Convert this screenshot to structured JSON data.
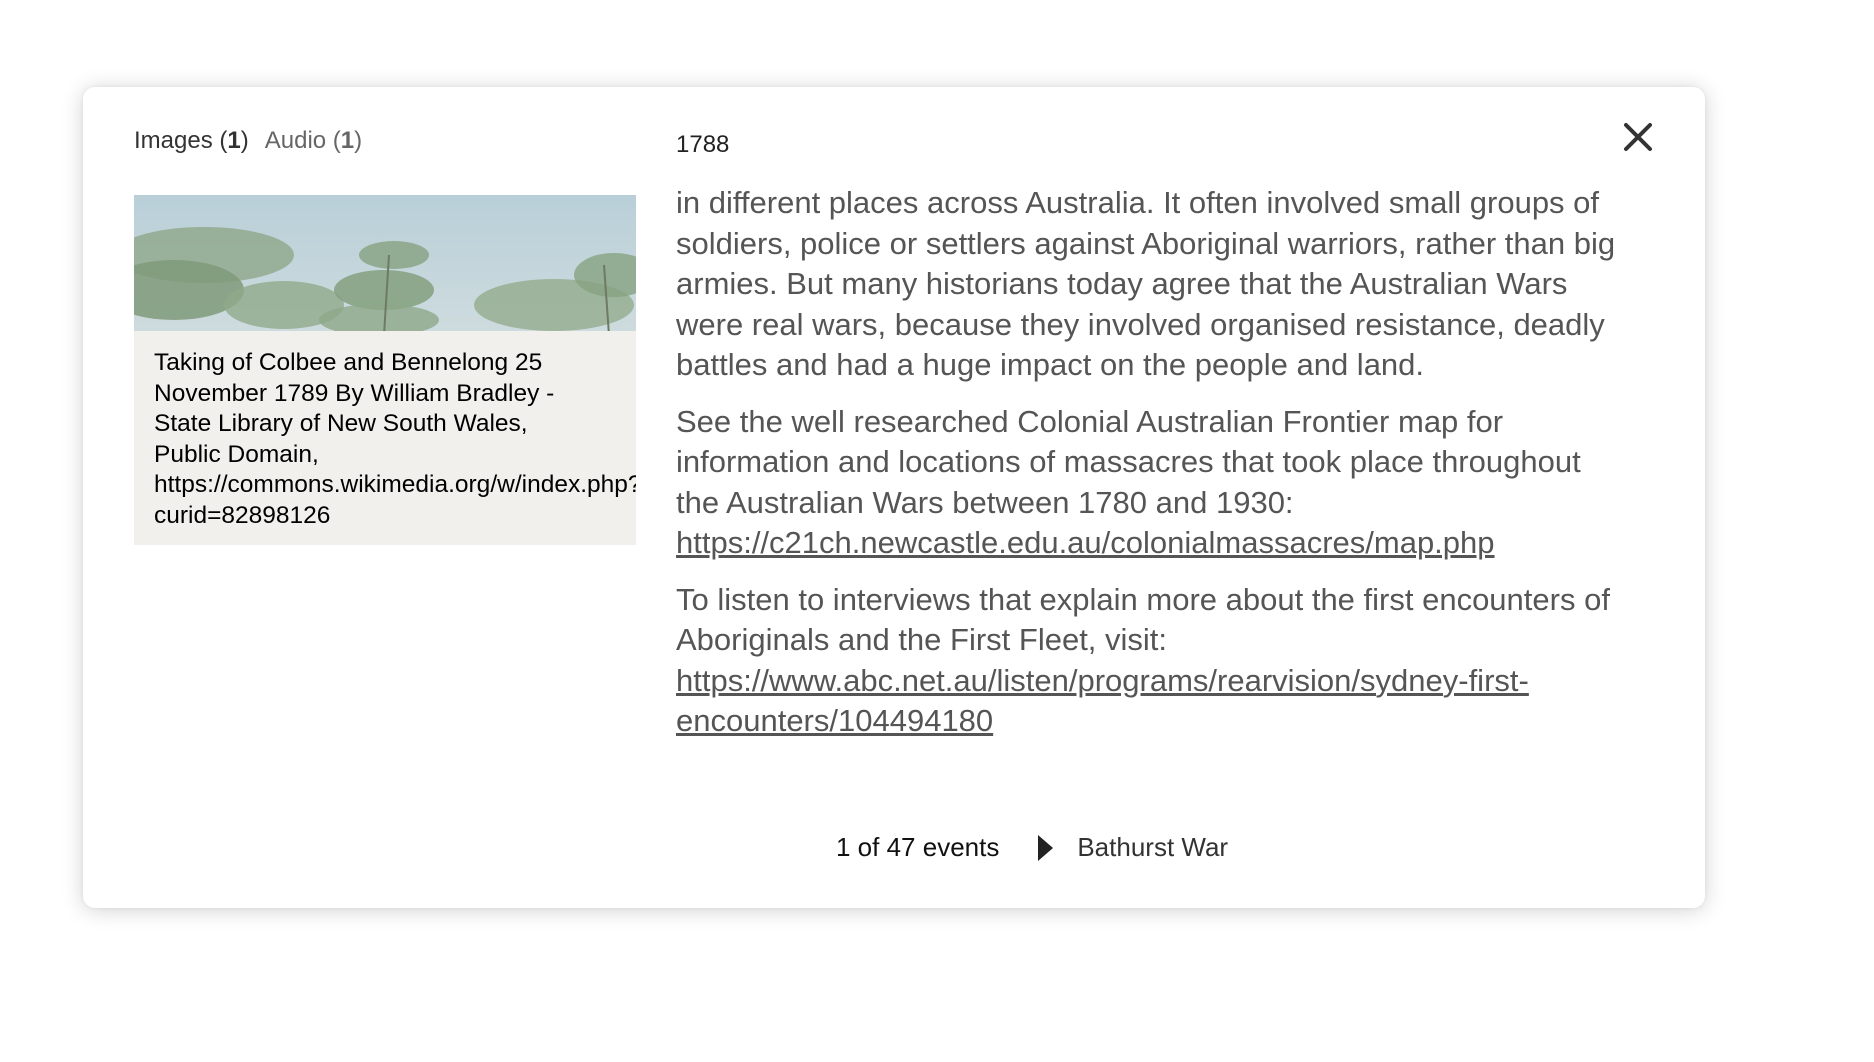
{
  "media_tabs": {
    "images_label": "Images (",
    "images_count": "1",
    "images_close": ")",
    "audio_label": "Audio (",
    "audio_count": "1",
    "audio_close": ")"
  },
  "image": {
    "caption": "Taking of Colbee and Bennelong 25\nNovember 1789 By William Bradley -\nState Library of New South Wales,\nPublic Domain,\nhttps://commons.wikimedia.org/w/index.php?\ncurid=82898126"
  },
  "event": {
    "year": "1788",
    "paragraph_1_partial": "in different places across Australia. It often involved small groups of soldiers, police or settlers against Aboriginal warriors, rather than big armies. But many historians today agree that the Australian Wars were real wars, because they involved organised resistance, deadly battles and had a huge impact on the people and land.",
    "paragraph_2": "See the well researched Colonial Australian Frontier map for information and locations of massacres that took place throughout the Australian Wars between 1780 and 1930:",
    "paragraph_2_link": "https://c21ch.newcastle.edu.au/colonialmassacres/map.php",
    "paragraph_3": "To listen to interviews that explain more about the first encounters of Aboriginals and the First Fleet, visit:",
    "paragraph_3_link": "https://www.abc.net.au/listen/programs/rearvision/sydney-first-encounters/104494180"
  },
  "footer": {
    "count_label": "1 of 47 events",
    "next_event_label": "Bathurst War"
  },
  "icons": {
    "close": "close-icon",
    "next": "triangle-right-icon"
  },
  "colors": {
    "body_text": "#555555",
    "heading_text": "#222222"
  }
}
